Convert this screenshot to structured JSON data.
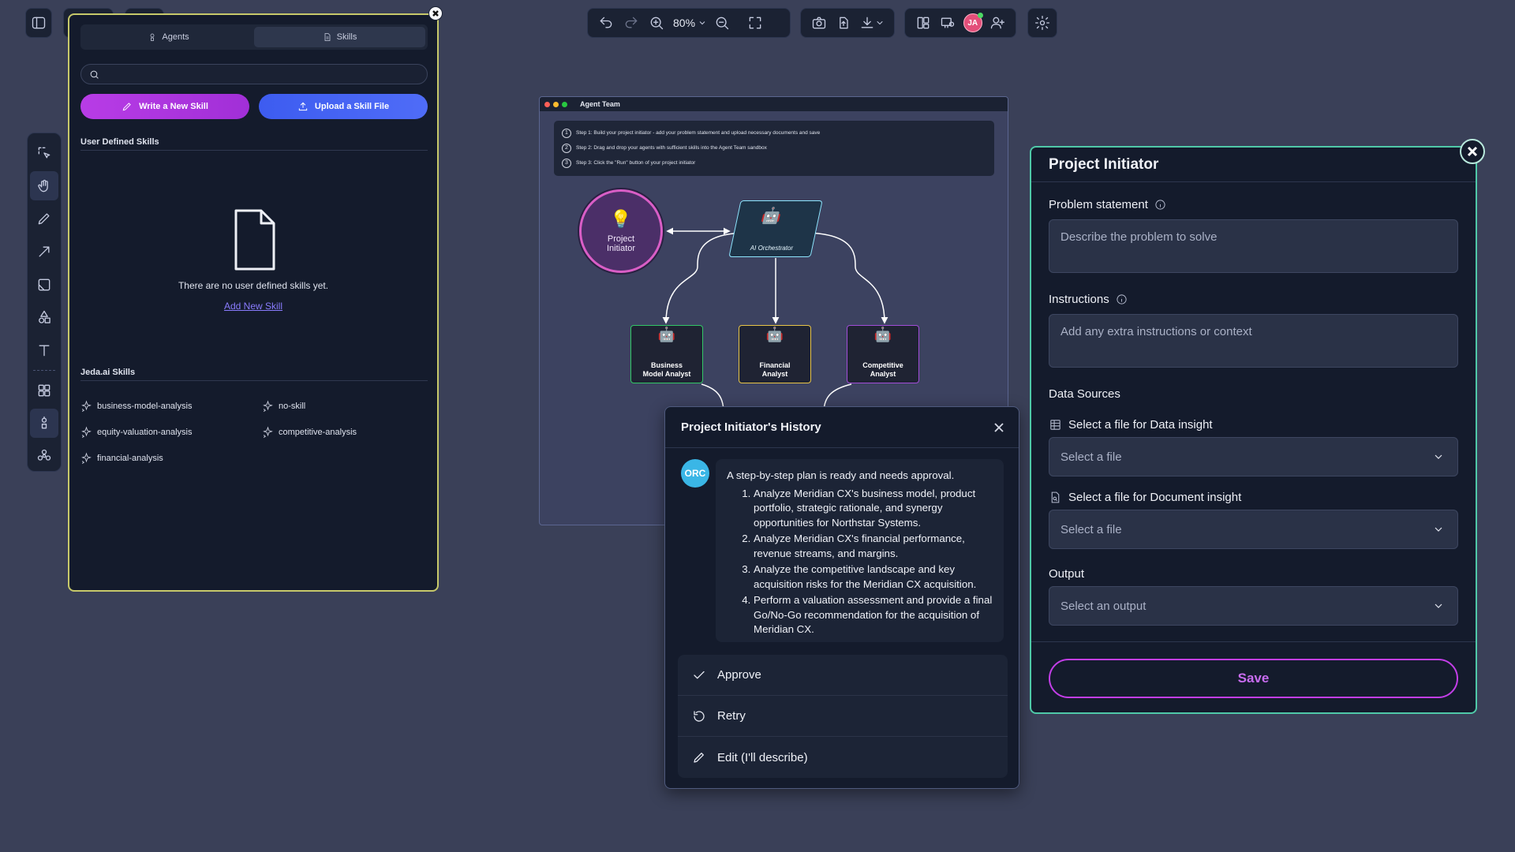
{
  "toolbar": {
    "zoom": "80%"
  },
  "avatar_initials": "JA",
  "skills_panel": {
    "tabs": [
      {
        "label": "Agents"
      },
      {
        "label": "Skills"
      }
    ],
    "search_placeholder": "",
    "write_button": "Write a New Skill",
    "upload_button": "Upload a Skill File",
    "user_section_title": "User Defined Skills",
    "empty_message": "There are no user defined skills yet.",
    "add_link": "Add New Skill",
    "jeda_section_title": "Jeda.ai Skills",
    "jeda_skills": [
      "business-model-analysis",
      "no-skill",
      "equity-valuation-analysis",
      "competitive-analysis",
      "financial-analysis"
    ]
  },
  "agent_team": {
    "title": "Agent Team",
    "steps": [
      {
        "num": "1",
        "text": "Step 1: Build your project initiator - add your problem statement and upload necessary documents and save"
      },
      {
        "num": "2",
        "text": "Step 2: Drag and drop your agents with sufficient skills into the Agent Team sandbox"
      },
      {
        "num": "3",
        "text": "Step 3: Click the \"Run\" button of your project initiator"
      }
    ],
    "initiator_label_1": "Project",
    "initiator_label_2": "Initiator",
    "orchestrator_label": "AI Orchestrator",
    "agents": [
      {
        "line1": "Business",
        "line2": "Model Analyst",
        "color": "#32c766"
      },
      {
        "line1": "Financial",
        "line2": "Analyst",
        "color": "#e8c547"
      },
      {
        "line1": "Competitive",
        "line2": "Analyst",
        "color": "#a24dd9"
      }
    ]
  },
  "history": {
    "title": "Project Initiator's History",
    "avatar": "ORC",
    "message_intro": "A step-by-step plan is ready and needs approval.",
    "plan": [
      "Analyze Meridian CX's business model, product portfolio, strategic rationale, and synergy opportunities for Northstar Systems.",
      "Analyze Meridian CX's financial performance, revenue streams, and margins.",
      "Analyze the competitive landscape and key acquisition risks for the Meridian CX acquisition.",
      "Perform a valuation assessment and provide a final Go/No-Go recommendation for the acquisition of Meridian CX."
    ],
    "actions": [
      {
        "label": "Approve",
        "icon": "check-icon"
      },
      {
        "label": "Retry",
        "icon": "retry-icon"
      },
      {
        "label": "Edit (I'll describe)",
        "icon": "pencil-icon"
      }
    ]
  },
  "project_initiator": {
    "title": "Project Initiator",
    "problem_label": "Problem statement",
    "problem_placeholder": "Describe the problem to solve",
    "instructions_label": "Instructions",
    "instructions_placeholder": "Add any extra instructions or context",
    "data_sources_label": "Data Sources",
    "data_insight_label": "Select a file for Data insight",
    "data_insight_value": "Select a file",
    "doc_insight_label": "Select a file for Document insight",
    "doc_insight_value": "Select a file",
    "output_label": "Output",
    "output_value": "Select an output",
    "save_label": "Save"
  }
}
